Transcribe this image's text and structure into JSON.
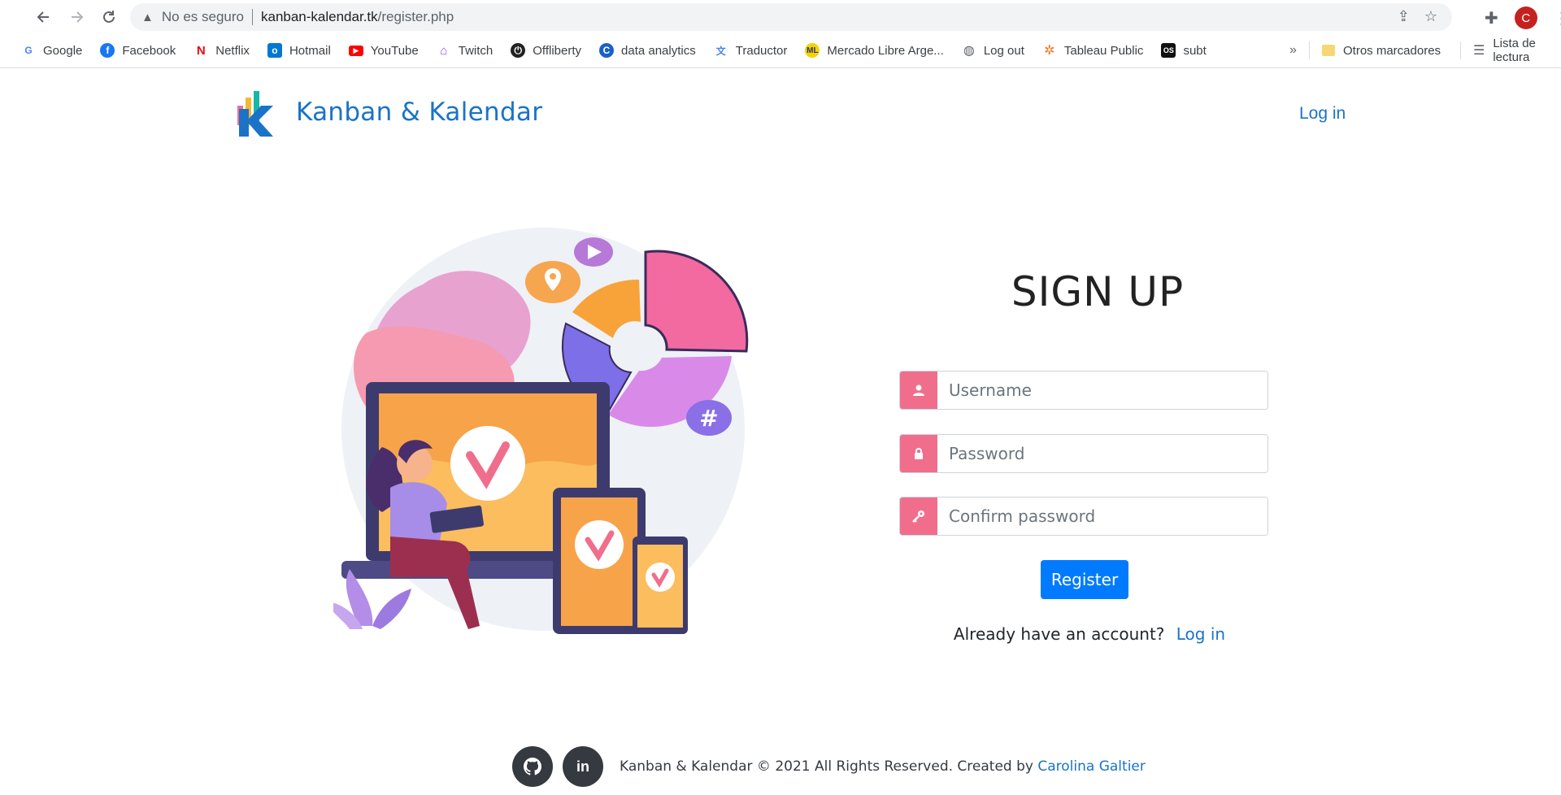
{
  "browser": {
    "security_label": "No es seguro",
    "url_host": "kanban-kalendar.tk",
    "url_path": "/register.php",
    "profile_initial": "C",
    "bookmarks": [
      {
        "label": "Google",
        "icon": "google-icon",
        "color": "#4285f4"
      },
      {
        "label": "Facebook",
        "icon": "facebook-icon",
        "color": "#1877f2"
      },
      {
        "label": "Netflix",
        "icon": "netflix-icon",
        "color": "#e50914"
      },
      {
        "label": "Hotmail",
        "icon": "outlook-icon",
        "color": "#0078d4"
      },
      {
        "label": "YouTube",
        "icon": "youtube-icon",
        "color": "#ff0000"
      },
      {
        "label": "Twitch",
        "icon": "twitch-icon",
        "color": "#9146ff"
      },
      {
        "label": "Offliberty",
        "icon": "power-icon",
        "color": "#222222"
      },
      {
        "label": "data analytics",
        "icon": "c-icon",
        "color": "#1a5fc9"
      },
      {
        "label": "Traductor",
        "icon": "translate-icon",
        "color": "#4285f4"
      },
      {
        "label": "Mercado Libre Arge...",
        "icon": "mercadolibre-icon",
        "color": "#f5d300"
      },
      {
        "label": "Log out",
        "icon": "globe-icon",
        "color": "#5f6368"
      },
      {
        "label": "Tableau Public",
        "icon": "tableau-icon",
        "color": "#e97627"
      },
      {
        "label": "subt",
        "icon": "subtitle-icon",
        "color": "#111111"
      }
    ],
    "more_label": "»",
    "other_bookmarks": "Otros marcadores",
    "reading_list": "Lista de lectura"
  },
  "site": {
    "brand": "Kanban & Kalendar",
    "header_login": "Log in",
    "brand_colors": {
      "pink": "#f06e8c",
      "teal": "#17b6a9",
      "blue": "#1a73c7"
    }
  },
  "form": {
    "title": "SIGN UP",
    "username_placeholder": "Username",
    "password_placeholder": "Password",
    "confirm_placeholder": "Confirm password",
    "register_label": "Register",
    "already_text": "Already have an account?",
    "login_link": "Log in",
    "accent": "#f06e8c",
    "button_color": "#007bff"
  },
  "footer": {
    "copyright": "Kanban & Kalendar © 2021 All Rights Reserved. Created by",
    "author": "Carolina Galtier",
    "social": [
      {
        "icon": "github-icon"
      },
      {
        "icon": "linkedin-icon",
        "label": "in"
      }
    ]
  }
}
